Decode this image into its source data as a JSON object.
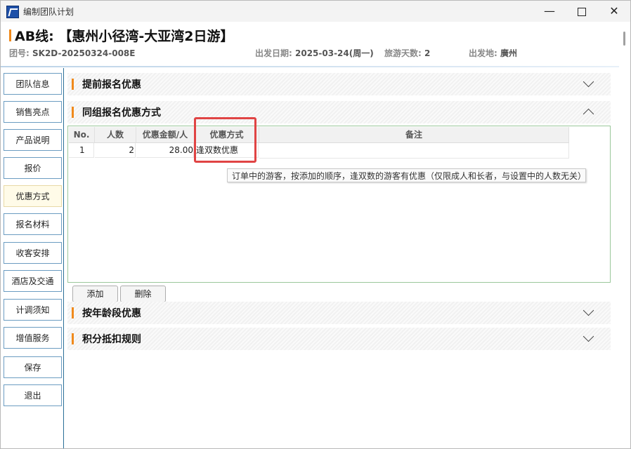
{
  "window": {
    "title": "编制团队计划"
  },
  "header": {
    "route_title": "AB线: 【惠州小径湾-大亚湾2日游】",
    "group_no_label": "团号:",
    "group_no": "SK2D-20250324-008E",
    "depart_date_label": "出发日期:",
    "depart_date": "2025-03-24(周一)",
    "days_label": "旅游天数:",
    "days": "2",
    "depart_place_label": "出发地:",
    "depart_place": "廣州"
  },
  "sidebar": {
    "items": [
      {
        "label": "团队信息"
      },
      {
        "label": "销售亮点"
      },
      {
        "label": "产品说明"
      },
      {
        "label": "报价"
      },
      {
        "label": "优惠方式"
      },
      {
        "label": "报名材料"
      },
      {
        "label": "收客安排"
      },
      {
        "label": "酒店及交通"
      },
      {
        "label": "计调须知"
      },
      {
        "label": "增值服务"
      },
      {
        "label": "保存"
      },
      {
        "label": "退出"
      }
    ],
    "active": "优惠方式"
  },
  "sections": {
    "early": "提前报名优惠",
    "group": "同组报名优惠方式",
    "age": "按年龄段优惠",
    "points": "积分抵扣规则"
  },
  "grid": {
    "headers": [
      "No.",
      "人数",
      "优惠金额/人",
      "优惠方式",
      "备注"
    ],
    "rows": [
      {
        "no": "1",
        "people": "2",
        "amount": "28.00",
        "method": "逢双数优惠",
        "remark": ""
      }
    ]
  },
  "tooltip": "订单中的游客，按添加的顺序，逢双数的游客有优惠（仅限成人和长者，与设置中的人数无关）",
  "buttons": {
    "add": "添加",
    "delete": "删除"
  },
  "colors": {
    "accent_bar": "#f08a1c",
    "highlight": "#e04444",
    "panel_border": "#9ac79a",
    "sidebar_border": "#6b9cc1"
  }
}
